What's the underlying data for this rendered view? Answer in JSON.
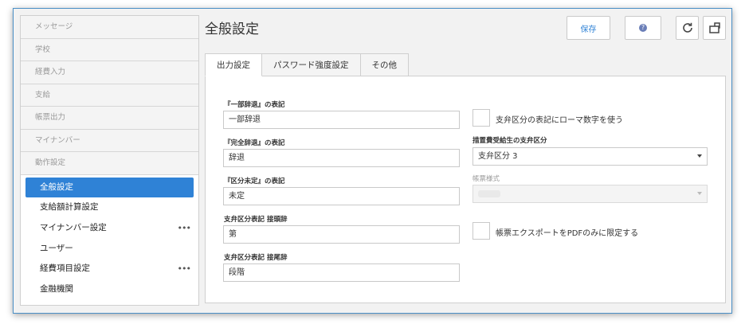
{
  "sidebar": {
    "groups": [
      "メッセージ",
      "学校",
      "経費入力",
      "支給",
      "帳票出力",
      "マイナンバー",
      "動作設定"
    ],
    "items": [
      {
        "label": "全般設定",
        "active": true,
        "more": ""
      },
      {
        "label": "支給額計算設定",
        "active": false,
        "more": ""
      },
      {
        "label": "マイナンバー設定",
        "active": false,
        "more": "•••"
      },
      {
        "label": "ユーザー",
        "active": false,
        "more": ""
      },
      {
        "label": "経費項目設定",
        "active": false,
        "more": "•••"
      },
      {
        "label": "金融機関",
        "active": false,
        "more": ""
      }
    ]
  },
  "header": {
    "title": "全般設定",
    "save_label": "保存",
    "help_glyph": "?",
    "refresh_icon": "refresh-icon",
    "popout_icon": "popout-icon"
  },
  "tabs": [
    "出力設定",
    "パスワード強度設定",
    "その他"
  ],
  "form": {
    "partial_label": "『一部辞退』の表記",
    "partial_value": "一部辞退",
    "full_label": "『完全辞退』の表記",
    "full_value": "辞退",
    "undecided_label": "『区分未定』の表記",
    "undecided_value": "未定",
    "prefix_label": "支弁区分表記 接頭辞",
    "prefix_value": "第",
    "suffix_label": "支弁区分表記 接尾辞",
    "suffix_value": "段階",
    "roman_checkbox_label": "支弁区分の表記にローマ数字を使う",
    "roman_checked": false,
    "measure_label": "措置費受給生の支弁区分",
    "measure_value": "支弁区分 3",
    "format_label": "帳票様式",
    "pdf_checkbox_label": "帳票エクスポートをPDFのみに限定する",
    "pdf_checked": false
  },
  "colors": {
    "accent": "#2f82d6",
    "window_border": "#4a8fc6"
  }
}
